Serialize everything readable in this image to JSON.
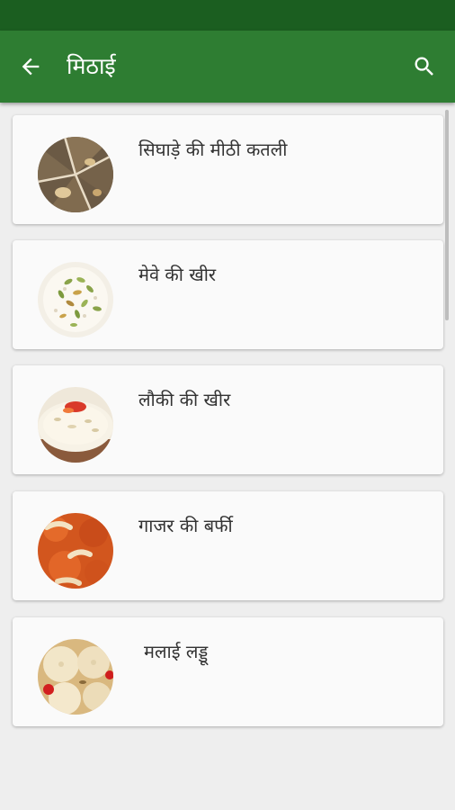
{
  "app_bar": {
    "title": "मिठाई",
    "back_icon": "arrow-back-icon",
    "search_icon": "search-icon",
    "color": "#2e7d32",
    "status_color": "#1b5e20"
  },
  "recipes": [
    {
      "title": "सिघाड़े की मीठी कतली",
      "image": "katli-photo"
    },
    {
      "title": "मेवे की खीर",
      "image": "mewa-kheer-photo"
    },
    {
      "title": "लौकी की खीर",
      "image": "lauki-kheer-photo"
    },
    {
      "title": "गाजर की बर्फी",
      "image": "gajar-barfi-photo"
    },
    {
      "title": "मलाई लड्डू",
      "image": "malai-laddu-photo"
    }
  ]
}
